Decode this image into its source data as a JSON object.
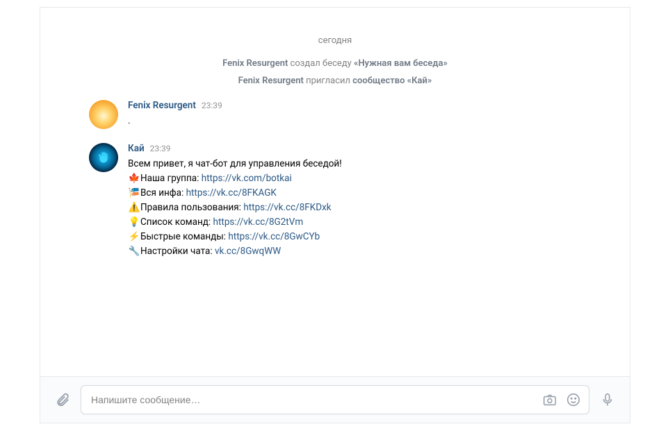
{
  "date_label": "сегодня",
  "system_messages": [
    {
      "actor": "Fenix Resurgent",
      "text_mid": " создал беседу ",
      "target": "«Нужная вам беседа»"
    },
    {
      "actor": "Fenix Resurgent",
      "text_mid": " пригласил ",
      "target": "сообщество «Кай»"
    }
  ],
  "messages": [
    {
      "sender": "Fenix Resurgent",
      "time": "23:39",
      "body": "."
    },
    {
      "sender": "Кай",
      "time": "23:39",
      "intro": "Всем привет, я чат-бот для управления беседой!",
      "lines": [
        {
          "emoji": "🍁",
          "label": "Наша группа: ",
          "link": "https://vk.com/botkai"
        },
        {
          "emoji": "🎏",
          "label": "Вся инфа: ",
          "link": "https://vk.cc/8FKAGK"
        },
        {
          "emoji": "⚠️",
          "label": "Правила пользования: ",
          "link": "https://vk.cc/8FKDxk"
        },
        {
          "emoji": "💡",
          "label": "Список команд: ",
          "link": "https://vk.cc/8G2tVm"
        },
        {
          "emoji": "⚡",
          "label": "Быстрые команды: ",
          "link": "https://vk.cc/8GwCYb"
        },
        {
          "emoji": "🔧",
          "label": "Настройки чата: ",
          "link": "vk.cc/8GwqWW"
        }
      ]
    }
  ],
  "composer": {
    "placeholder": "Напишите сообщение…"
  }
}
